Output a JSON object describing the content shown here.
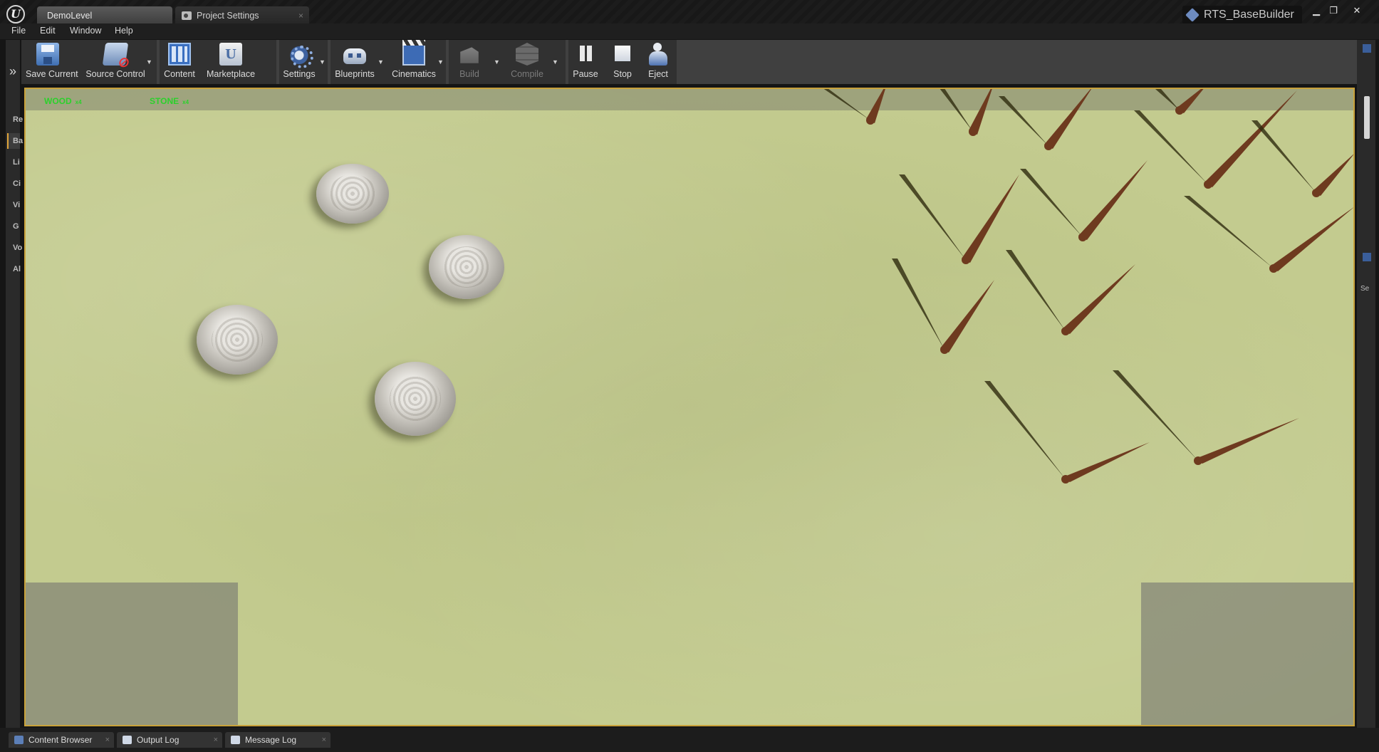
{
  "window": {
    "tabs": [
      {
        "label": "DemoLevel",
        "close": ""
      },
      {
        "label": "Project Settings",
        "close": "×"
      }
    ],
    "project_name": "RTS_BaseBuilder",
    "controls": {
      "minimize": "▁",
      "maximize": "❐",
      "close": "✕"
    }
  },
  "menu": [
    "File",
    "Edit",
    "Window",
    "Help"
  ],
  "left_panel": {
    "expand_glyph": "»",
    "tabs": [
      {
        "label": "Re",
        "active": false
      },
      {
        "label": "Ba",
        "active": true
      },
      {
        "label": "Li",
        "active": false
      },
      {
        "label": "Ci",
        "active": false
      },
      {
        "label": "Vi",
        "active": false
      },
      {
        "label": "G",
        "active": false
      },
      {
        "label": "Vo",
        "active": false
      },
      {
        "label": "Al",
        "active": false
      }
    ]
  },
  "toolbar": {
    "save": {
      "label": "Save Current",
      "icon": "save-icon"
    },
    "source_control": {
      "label": "Source Control",
      "icon": "source-control-icon"
    },
    "content": {
      "label": "Content",
      "icon": "content-icon"
    },
    "marketplace": {
      "label": "Marketplace",
      "icon": "marketplace-icon"
    },
    "settings": {
      "label": "Settings",
      "icon": "settings-icon"
    },
    "blueprints": {
      "label": "Blueprints",
      "icon": "blueprints-icon"
    },
    "cinematics": {
      "label": "Cinematics",
      "icon": "cinematics-icon"
    },
    "build": {
      "label": "Build",
      "icon": "build-icon",
      "enabled": false
    },
    "compile": {
      "label": "Compile",
      "icon": "compile-icon",
      "enabled": false
    },
    "pause": {
      "label": "Pause",
      "icon": "pause-icon"
    },
    "stop": {
      "label": "Stop",
      "icon": "stop-icon"
    },
    "eject": {
      "label": "Eject",
      "icon": "eject-icon"
    },
    "dropdown_glyph": "▼"
  },
  "hud": {
    "wood_label": "WOOD",
    "wood_unit": "x4",
    "stone_label": "STONE",
    "stone_unit": "x4"
  },
  "right_panel": {
    "label": "Se"
  },
  "bottom_tabs": [
    {
      "label": "Content Browser",
      "close": "×"
    },
    {
      "label": "Output Log",
      "close": "×"
    },
    {
      "label": "Message Log",
      "close": "×"
    }
  ],
  "colors": {
    "accent": "#c9a23a",
    "hud_text": "#2bd12b",
    "ground": "#c3cb8f",
    "tree_trunk": "#6e3a1f",
    "tree_shadow": "#2e2b0e"
  }
}
